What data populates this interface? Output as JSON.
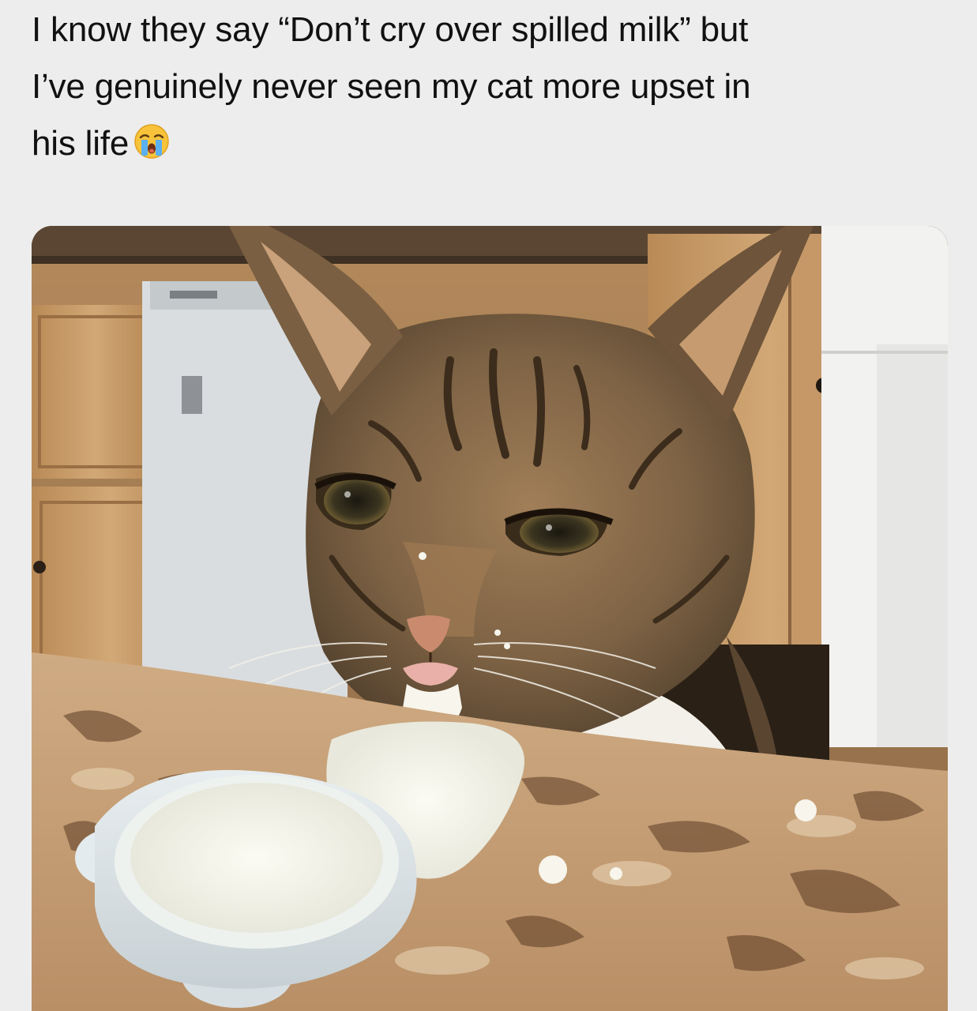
{
  "post": {
    "caption_line_1": "I know they say “Don’t cry over spilled milk” but",
    "caption_line_2": "I’ve genuinely never seen my cat more upset in",
    "caption_line_3": "his life",
    "caption_emoji": "crying-face-emoji"
  },
  "photo": {
    "subject": "cat-with-spilled-milk-photo",
    "colors": {
      "background": "#ededed",
      "text": "#111111",
      "cabinet": "#c9a173",
      "counter": "#c7a077",
      "fur": "#8c6f4e",
      "milk": "#f4f3ea"
    }
  }
}
